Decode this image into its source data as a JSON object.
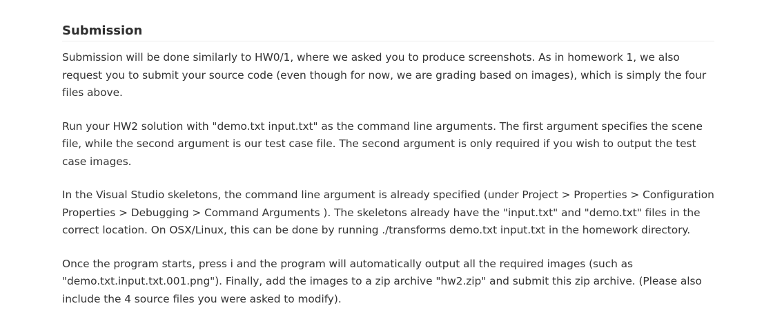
{
  "section": {
    "heading": "Submission",
    "paragraphs": [
      "Submission will be done similarly to HW0/1, where we asked you to produce screenshots.  As in homework 1, we also request you to submit your source code (even though for now, we are grading based on images), which is simply the four files above.",
      "Run your HW2 solution with \"demo.txt input.txt\" as the command line arguments. The first argument specifies the scene file, while the second argument is our test case file. The second argument is only required if you wish to output the test case images.",
      "In the Visual Studio skeletons, the command line argument is already specified (under Project > Properties > Configuration Properties > Debugging > Command Arguments ). The skeletons already have the \"input.txt\" and \"demo.txt\" files in the correct location. On OSX/Linux, this can be done by running ./transforms demo.txt input.txt in the homework directory.",
      "Once the program starts, press i and the program will automatically output all the required images (such as \"demo.txt.input.txt.001.png\"). Finally, add the images to a zip archive \"hw2.zip\" and submit this zip archive.  (Please also include the 4 source files you were asked to modify)."
    ]
  }
}
